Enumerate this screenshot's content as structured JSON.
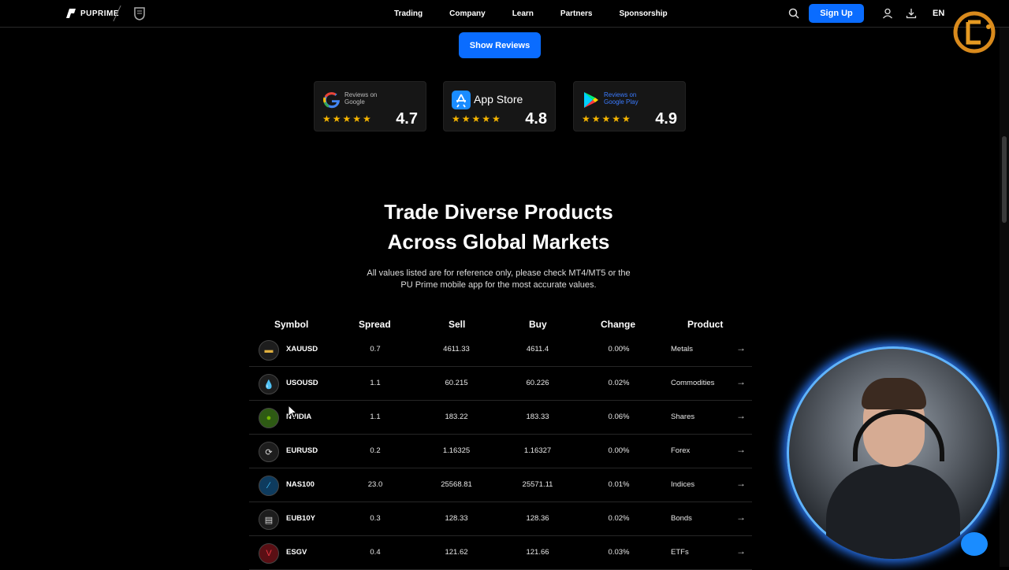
{
  "nav": {
    "brand": "PUPRIME",
    "menu": [
      "Trading",
      "Company",
      "Learn",
      "Partners",
      "Sponsorship"
    ],
    "signup_label": "Sign Up",
    "language": "EN"
  },
  "reviews": {
    "show_label": "Show Reviews",
    "cards": [
      {
        "label": "Reviews on Google",
        "score": "4.7",
        "stars": "★★★★★"
      },
      {
        "label": "App Store",
        "score": "4.8",
        "stars": "★★★★★"
      },
      {
        "label": "Reviews on Google Play",
        "score": "4.9",
        "stars": "★★★★★"
      }
    ]
  },
  "section": {
    "title_line1": "Trade Diverse Products",
    "title_line2": "Across Global Markets",
    "subtitle_line1": "All values listed are for reference only, please check MT4/MT5 or the",
    "subtitle_line2": "PU Prime mobile app for the most accurate values."
  },
  "table": {
    "headers": [
      "Symbol",
      "Spread",
      "Sell",
      "Buy",
      "Change",
      "Product"
    ],
    "rows": [
      {
        "symbol": "XAUUSD",
        "spread": "0.7",
        "sell": "4611.33",
        "buy": "4611.4",
        "change": "0.00%",
        "product": "Metals"
      },
      {
        "symbol": "USOUSD",
        "spread": "1.1",
        "sell": "60.215",
        "buy": "60.226",
        "change": "0.02%",
        "product": "Commodities"
      },
      {
        "symbol": "NVIDIA",
        "spread": "1.1",
        "sell": "183.22",
        "buy": "183.33",
        "change": "0.06%",
        "product": "Shares"
      },
      {
        "symbol": "EURUSD",
        "spread": "0.2",
        "sell": "1.16325",
        "buy": "1.16327",
        "change": "0.00%",
        "product": "Forex"
      },
      {
        "symbol": "NAS100",
        "spread": "23.0",
        "sell": "25568.81",
        "buy": "25571.11",
        "change": "0.01%",
        "product": "Indices"
      },
      {
        "symbol": "EUB10Y",
        "spread": "0.3",
        "sell": "128.33",
        "buy": "128.36",
        "change": "0.02%",
        "product": "Bonds"
      },
      {
        "symbol": "ESGV",
        "spread": "0.4",
        "sell": "121.62",
        "buy": "121.66",
        "change": "0.03%",
        "product": "ETFs"
      }
    ]
  },
  "colors": {
    "accent": "#0a6cff",
    "star": "#f7b500",
    "background": "#000000"
  }
}
